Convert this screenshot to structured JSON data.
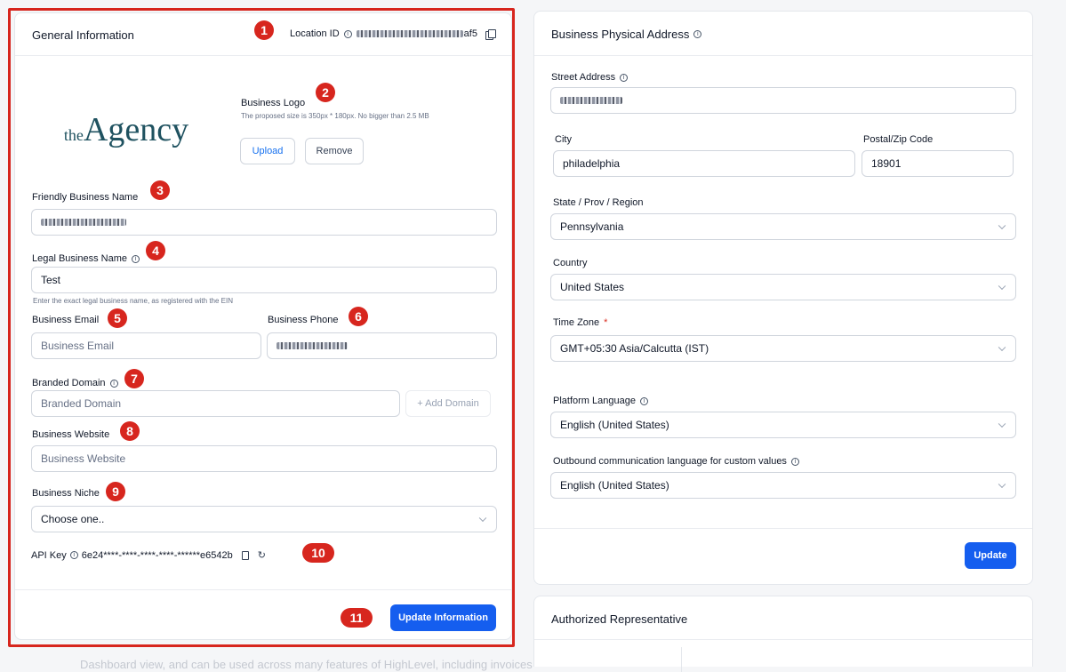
{
  "general": {
    "title": "General Information",
    "location_id_label": "Location ID",
    "location_id_suffix": "af5",
    "logo_text_small": "the",
    "logo_text_main": "Agency",
    "logo_label": "Business Logo",
    "logo_hint": "The proposed size is 350px * 180px. No bigger than 2.5 MB",
    "upload_label": "Upload",
    "remove_label": "Remove",
    "friendly_name_label": "Friendly Business Name",
    "legal_name_label": "Legal Business Name",
    "legal_name_value": "Test",
    "legal_name_hint": "Enter the exact legal business name, as registered with the EIN",
    "email_label": "Business Email",
    "email_placeholder": "Business Email",
    "phone_label": "Business Phone",
    "domain_label": "Branded Domain",
    "domain_placeholder": "Branded Domain",
    "add_domain_label": "+ Add Domain",
    "website_label": "Business Website",
    "website_placeholder": "Business Website",
    "niche_label": "Business Niche",
    "niche_value": "Choose one..",
    "api_key_label": "API Key",
    "api_key_value": "6e24****-****-****-****-******e6542b",
    "update_label": "Update Information"
  },
  "address": {
    "title": "Business Physical Address",
    "street_label": "Street Address",
    "city_label": "City",
    "city_value": "philadelphia",
    "zip_label": "Postal/Zip Code",
    "zip_value": "18901",
    "state_label": "State / Prov / Region",
    "state_value": "Pennsylvania",
    "country_label": "Country",
    "country_value": "United States",
    "timezone_label": "Time Zone",
    "timezone_required": "*",
    "timezone_value": "GMT+05:30 Asia/Calcutta (IST)",
    "platform_lang_label": "Platform Language",
    "platform_lang_value": "English (United States)",
    "outbound_lang_label": "Outbound communication language for custom values",
    "outbound_lang_value": "English (United States)",
    "update_label": "Update"
  },
  "authorized": {
    "title": "Authorized Representative"
  },
  "badges": [
    "1",
    "2",
    "3",
    "4",
    "5",
    "6",
    "7",
    "8",
    "9",
    "10",
    "11"
  ],
  "footer_text": "Dashboard view, and can be used across many features of HighLevel, including invoices",
  "colors": {
    "accent": "#155eef",
    "annotation": "#d7261e",
    "logo": "#1f5260"
  }
}
